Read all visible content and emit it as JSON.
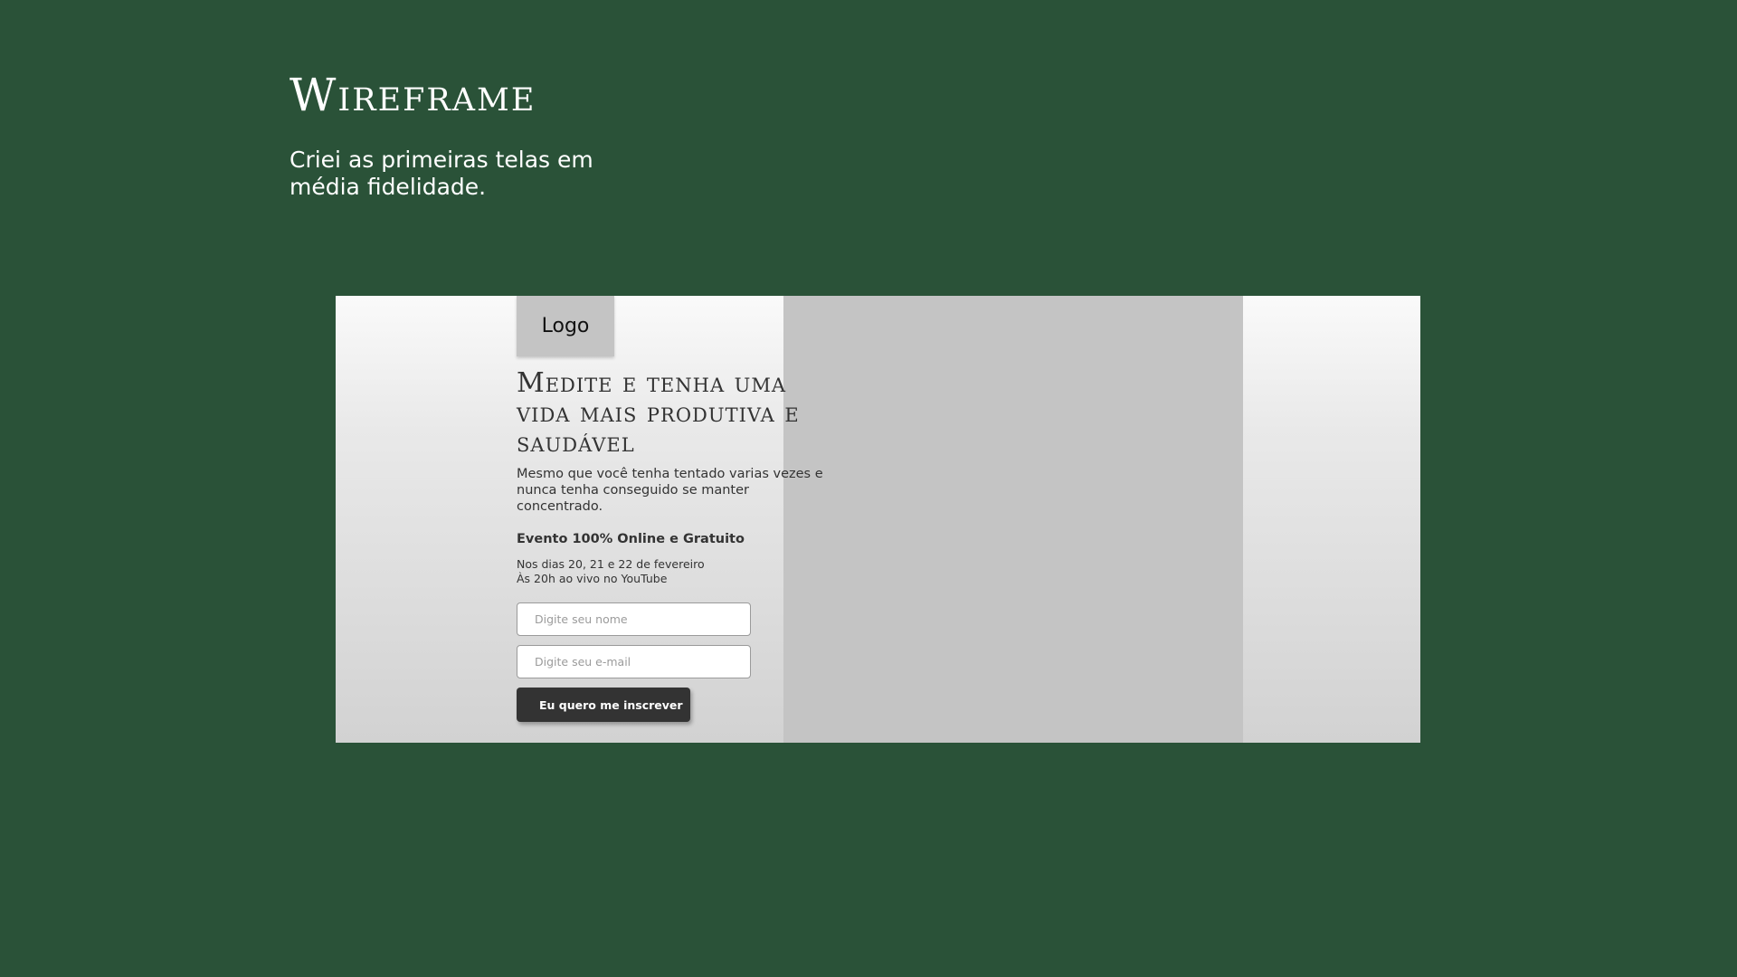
{
  "slide": {
    "title": "Wireframe",
    "subtitle": "Criei as primeiras telas em média fidelidade."
  },
  "mockup": {
    "logo_label": "Logo",
    "hero_title": "Medite e tenha uma vida mais produtiva e saudável",
    "hero_description": "Mesmo que você tenha tentado varias vezes e nunca tenha conseguido se manter concentrado.",
    "event": {
      "heading": "Evento 100% Online e Gratuito",
      "dates_line": "Nos dias 20, 21 e 22 de fevereiro",
      "time_line": "Às 20h ao vivo no YouTube"
    },
    "form": {
      "name_placeholder": "Digite seu nome",
      "email_placeholder": "Digite seu e-mail",
      "submit_label": "Eu quero me inscrever"
    }
  },
  "colors": {
    "slide_background": "#2a5238",
    "placeholder_gray": "#c4c4c4",
    "button_dark": "#333333"
  }
}
